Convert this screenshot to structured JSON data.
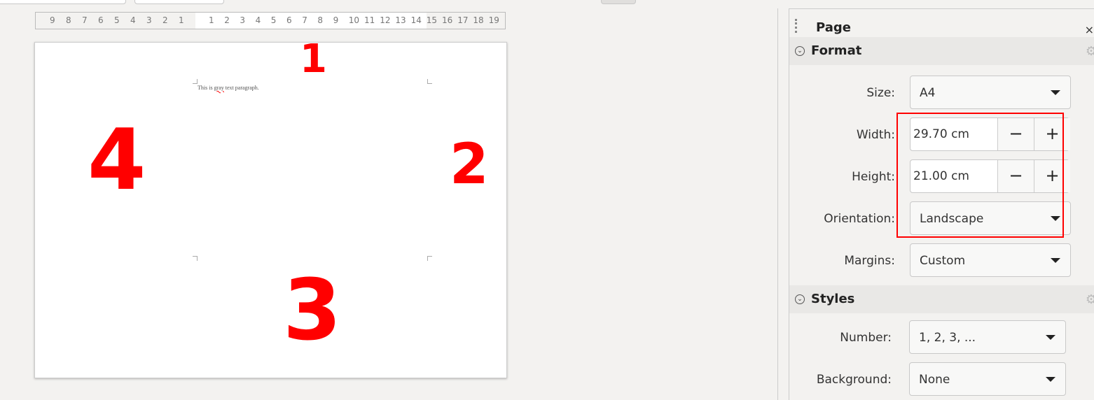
{
  "ruler": {
    "left_numbers": [
      "9",
      "8",
      "7",
      "6",
      "5",
      "4",
      "3",
      "2",
      "1"
    ],
    "right_numbers": [
      "1",
      "2",
      "3",
      "4",
      "5",
      "6",
      "7",
      "8",
      "9",
      "10",
      "11",
      "12",
      "13",
      "14",
      "15",
      "16",
      "17",
      "18",
      "19"
    ]
  },
  "document": {
    "text_before": "This is ",
    "text_squiggle": "gray",
    "text_after": " text paragraph."
  },
  "annotations": {
    "one": "1",
    "two": "2",
    "three": "3",
    "four": "4",
    "color": "#ff0000"
  },
  "sidebar": {
    "title": "Page",
    "close": "×",
    "format": {
      "label": "Format",
      "size_label": "Size:",
      "size_value": "A4",
      "width_label": "Width:",
      "width_value": "29.70 cm",
      "height_label": "Height:",
      "height_value": "21.00 cm",
      "orientation_label": "Orientation:",
      "orientation_value": "Landscape",
      "margins_label": "Margins:",
      "margins_value": "Custom",
      "minus": "−",
      "plus": "+"
    },
    "styles": {
      "label": "Styles",
      "number_label": "Number:",
      "number_value": "1, 2, 3, ...",
      "background_label": "Background:",
      "background_value": "None"
    }
  }
}
